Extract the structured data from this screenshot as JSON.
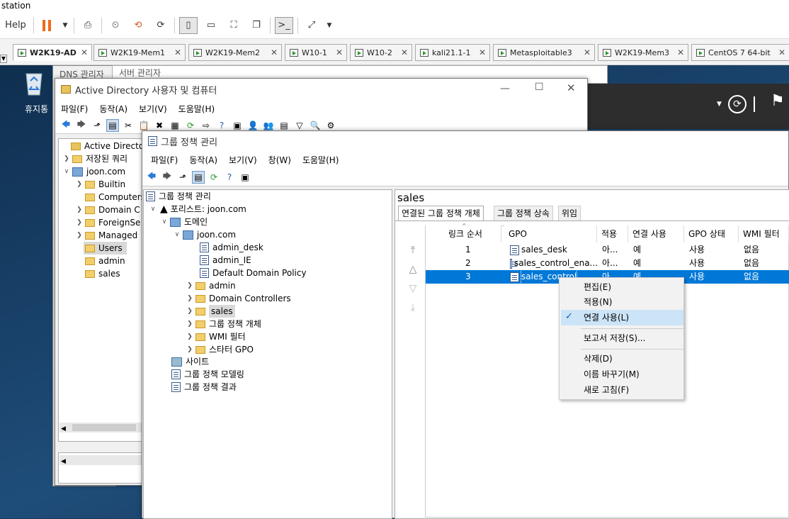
{
  "host": {
    "title": "station",
    "menu_help": "Help"
  },
  "tabs": [
    {
      "label": "W2K19-AD",
      "active": true
    },
    {
      "label": "W2K19-Mem1"
    },
    {
      "label": "W2K19-Mem2"
    },
    {
      "label": "W10-1"
    },
    {
      "label": "W10-2"
    },
    {
      "label": "kali21.1-1"
    },
    {
      "label": "Metasploitable3"
    },
    {
      "label": "W2K19-Mem3"
    },
    {
      "label": "CentOS 7 64-bit"
    }
  ],
  "desktop": {
    "recycle_bin": "휴지통",
    "dns_title": "DNS 관리자",
    "server_manager": "서버 관리자"
  },
  "ad": {
    "title": "Active Directory 사용자 및 컴퓨터",
    "menu": [
      "파일(F)",
      "동작(A)",
      "보기(V)",
      "도움말(H)"
    ],
    "tree": [
      "Active Directory",
      "저장된 쿼리",
      "joon.com",
      "Builtin",
      "Computers",
      "Domain C",
      "ForeignSe",
      "Managed",
      "Users",
      "admin",
      "sales"
    ]
  },
  "gpm": {
    "title": "그룹 정책 관리",
    "menu": [
      "파일(F)",
      "동작(A)",
      "보기(V)",
      "창(W)",
      "도움말(H)"
    ],
    "tree": {
      "root": "그룹 정책 관리",
      "forest": "포리스트: joon.com",
      "domains": "도메인",
      "domain": "joon.com",
      "items": [
        "admin_desk",
        "admin_IE",
        "Default Domain Policy",
        "admin",
        "Domain Controllers",
        "sales",
        "그룹 정책 개체",
        "WMI 필터",
        "스타터 GPO"
      ],
      "sites": "사이트",
      "modeling": "그룹 정책 모델링",
      "results": "그룹 정책 결과"
    },
    "right": {
      "heading": "sales",
      "tabs": [
        "연결된 그룹 정책 개체",
        "그룹 정책 상속",
        "위임"
      ],
      "columns": [
        "링크 순서",
        "GPO",
        "적용",
        "연결 사용",
        "GPO 상태",
        "WMI 필터"
      ],
      "rows": [
        {
          "order": "1",
          "gpo": "sales_desk",
          "enforced": "아...",
          "link": "예",
          "status": "사용",
          "wmi": "없음"
        },
        {
          "order": "2",
          "gpo": "sales_control_ena...",
          "enforced": "아...",
          "link": "예",
          "status": "사용",
          "wmi": "없음"
        },
        {
          "order": "3",
          "gpo": "sales_control",
          "enforced": "아...",
          "link": "예",
          "status": "사용",
          "wmi": "없음"
        }
      ]
    }
  },
  "context_menu": {
    "items": [
      "편집(E)",
      "적용(N)",
      "연결 사용(L)",
      "보고서 저장(S)...",
      "삭제(D)",
      "이름 바꾸기(M)",
      "새로 고침(F)"
    ]
  }
}
